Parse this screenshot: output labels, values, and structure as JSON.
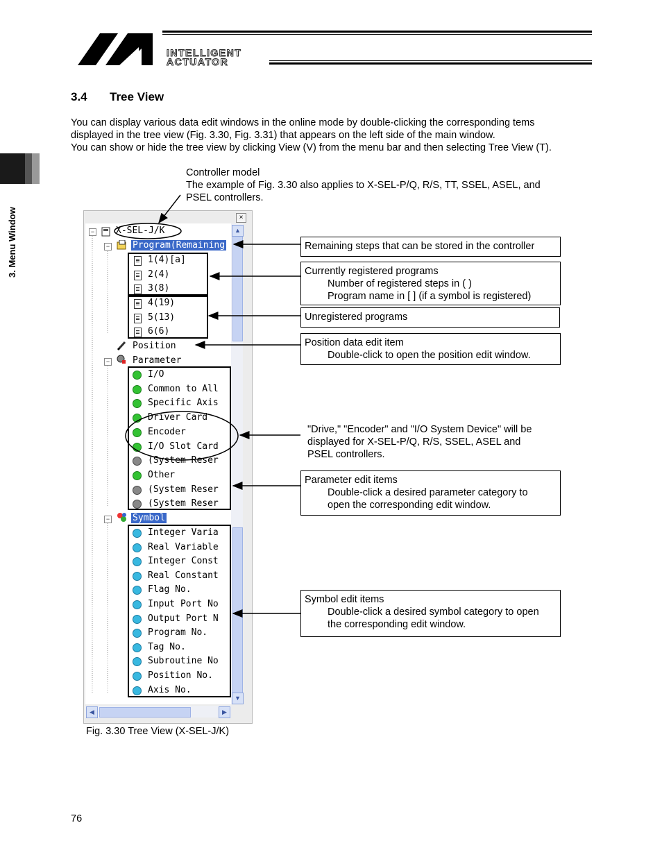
{
  "logo": {
    "line1": "INTELLIGENT",
    "line2": "ACTUATOR"
  },
  "side_tab": "3. Menu Window",
  "section": {
    "number": "3.4",
    "title": "Tree View"
  },
  "intro": [
    "You can display various data edit windows in the online mode by double-clicking the corresponding tems",
    "displayed in the tree view (Fig. 3.30, Fig. 3.31) that appears on the left side of the main window.",
    "You can show or hide the tree view by clicking View (V) from the menu bar and then selecting Tree View (T)."
  ],
  "model_note": {
    "title": "Controller model",
    "lines": [
      "The example of Fig. 3.30 also applies to X-SEL-P/Q, R/S, TT, SSEL, ASEL, and",
      "PSEL controllers."
    ]
  },
  "tree": {
    "close": "×",
    "root": "X-SEL-J/K",
    "program_node": "Program(Remaining",
    "registered_programs": [
      "1(4)[a]",
      "2(4)",
      "3(8)"
    ],
    "unregistered_programs": [
      "4(19)",
      "5(13)",
      "6(6)"
    ],
    "position": "Position",
    "parameter": "Parameter",
    "parameter_items": [
      {
        "label": "I/O",
        "status": "green"
      },
      {
        "label": "Common to All",
        "status": "green"
      },
      {
        "label": "Specific Axis",
        "status": "green"
      },
      {
        "label": "Driver Card",
        "status": "green"
      },
      {
        "label": "Encoder",
        "status": "green"
      },
      {
        "label": "I/O Slot Card",
        "status": "green"
      },
      {
        "label": "(System Reser",
        "status": "gray"
      },
      {
        "label": "Other",
        "status": "green"
      },
      {
        "label": "(System Reser",
        "status": "gray"
      },
      {
        "label": "(System Reser",
        "status": "gray"
      }
    ],
    "symbol": "Symbol",
    "symbol_items": [
      "Integer Varia",
      "Real Variable",
      "Integer Const",
      "Real Constant",
      "Flag No.",
      "Input Port No",
      "Output Port N",
      "Program No.",
      "Tag No.",
      "Subroutine No",
      "Position No.",
      "Axis No."
    ]
  },
  "callouts": {
    "remaining": "Remaining steps that can be stored in the controller",
    "registered": {
      "title": "Currently registered programs",
      "line1": "Number of registered steps in (    )",
      "line2": "Program name in [    ] (if a symbol is registered)"
    },
    "unregistered": "Unregistered programs",
    "position": {
      "title": "Position data edit item",
      "line1": "Double-click to open the position edit window."
    },
    "drive_note": [
      "\"Drive,\" \"Encoder\" and \"I/O System Device\" will be",
      "displayed for X-SEL-P/Q, R/S, SSEL, ASEL and",
      "PSEL controllers."
    ],
    "parameter": {
      "title": "Parameter edit items",
      "line1": "Double-click a desired parameter category to",
      "line2": "open the corresponding edit window."
    },
    "symbol": {
      "title": "Symbol edit items",
      "line1": "Double-click a desired symbol category to open",
      "line2": "the corresponding edit window."
    }
  },
  "caption": "Fig. 3.30 Tree View (X-SEL-J/K)",
  "page_number": "76"
}
